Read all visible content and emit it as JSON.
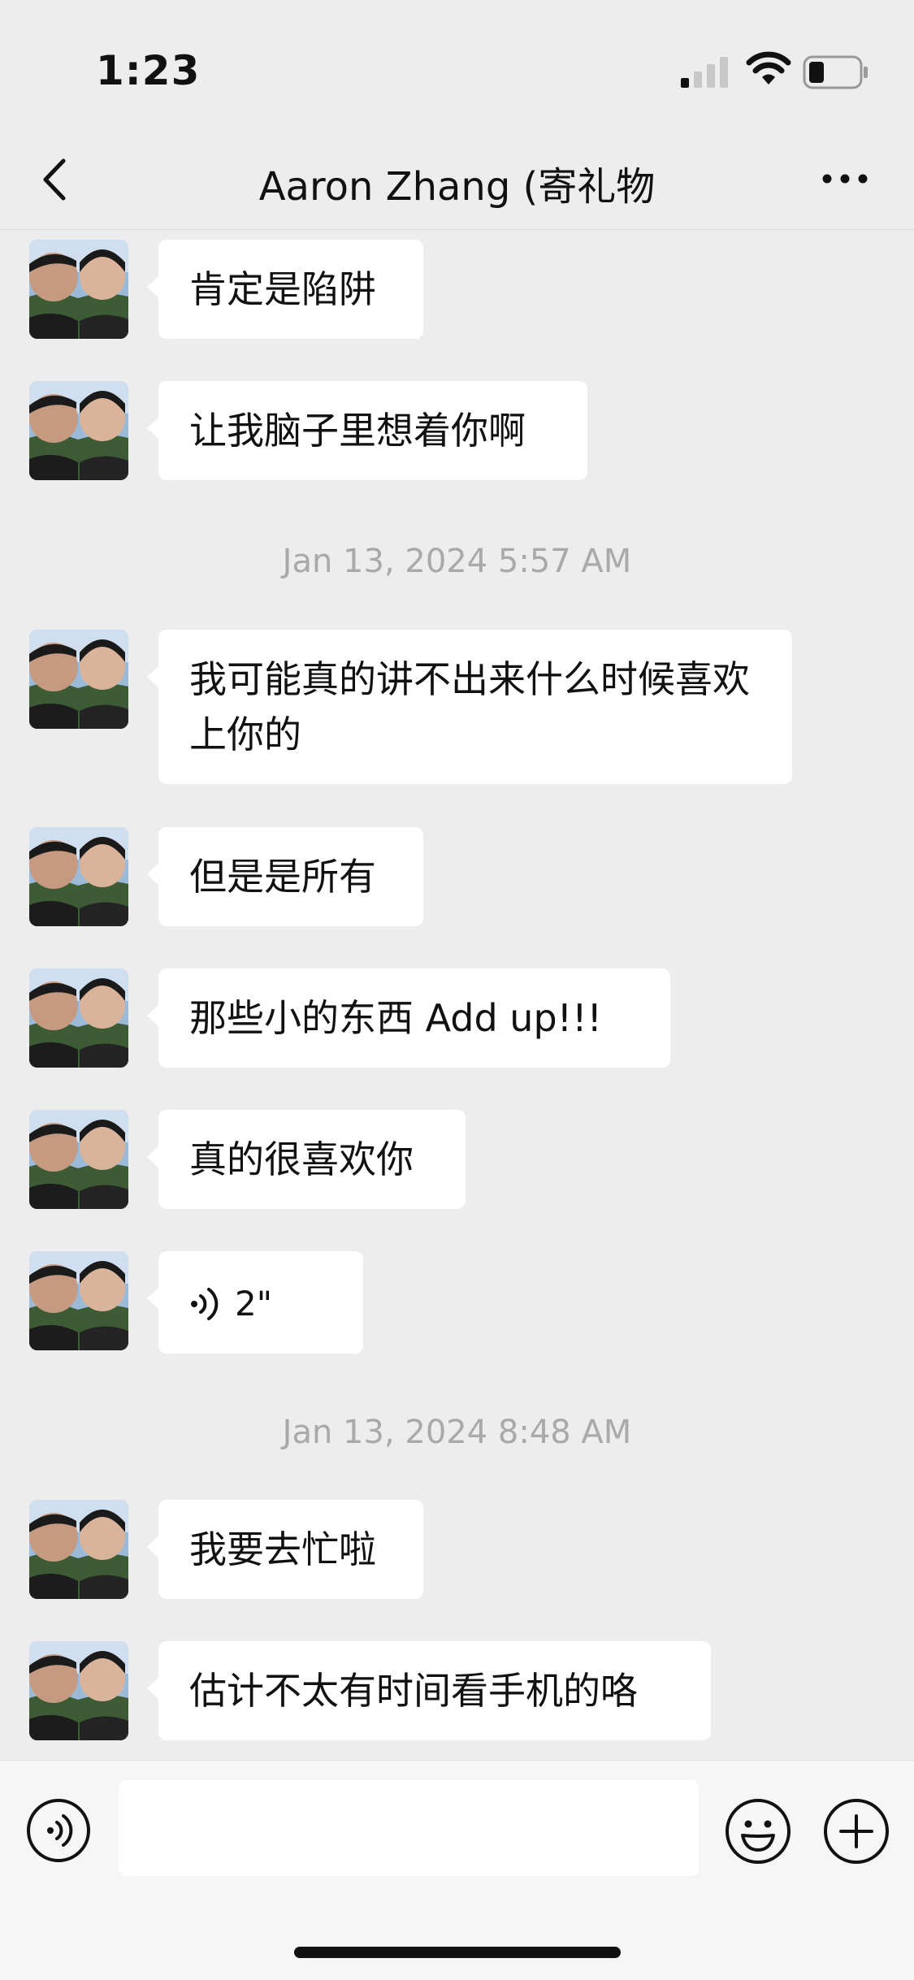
{
  "status": {
    "time": "1:23"
  },
  "nav": {
    "title": "Aaron Zhang (寄礼物"
  },
  "messages": [
    {
      "type": "text",
      "text": "肯定是陷阱"
    },
    {
      "type": "text",
      "text": "让我脑子里想着你啊"
    },
    {
      "type": "timestamp",
      "text": "Jan 13, 2024 5:57 AM"
    },
    {
      "type": "text",
      "text": "我可能真的讲不出来什么时候喜欢上你的"
    },
    {
      "type": "text",
      "text": "但是是所有"
    },
    {
      "type": "text",
      "text": "那些小的东西 Add up!!!"
    },
    {
      "type": "text",
      "text": "真的很喜欢你"
    },
    {
      "type": "voice",
      "text": "2\""
    },
    {
      "type": "timestamp",
      "text": "Jan 13, 2024 8:48 AM"
    },
    {
      "type": "text",
      "text": "我要去忙啦"
    },
    {
      "type": "text",
      "text": "估计不太有时间看手机的咯"
    }
  ],
  "input": {
    "placeholder": ""
  },
  "icons": {
    "back": "chevron-left-icon",
    "more": "more-dots-icon",
    "voice": "voice-wave-icon",
    "emoji": "emoji-icon",
    "plus": "plus-icon"
  },
  "colors": {
    "background": "#ededed",
    "bubble": "#ffffff",
    "timestamp": "#a9a9a9"
  }
}
